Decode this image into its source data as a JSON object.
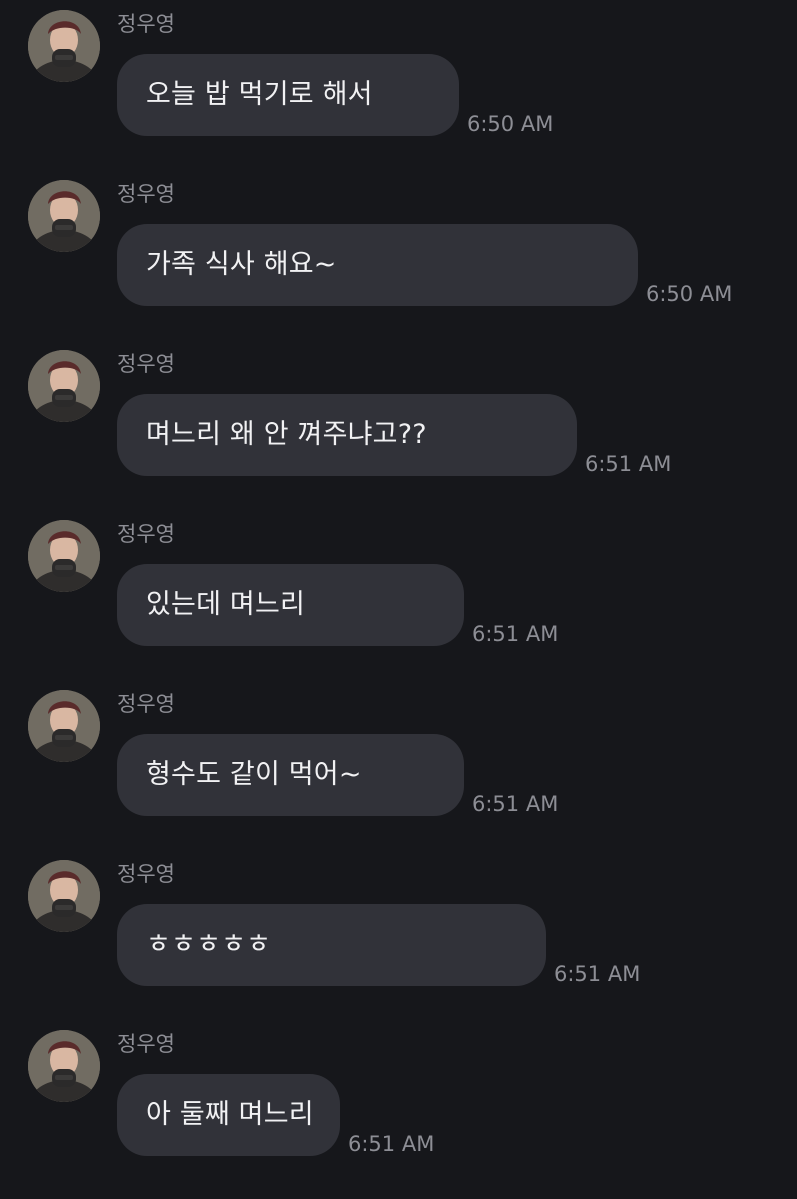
{
  "conversation": {
    "messages": [
      {
        "sender": "정우영",
        "text": "오늘 밥 먹기로 해서",
        "time": "6:50 AM"
      },
      {
        "sender": "정우영",
        "text": "가족 식사 해요~",
        "time": "6:50 AM"
      },
      {
        "sender": "정우영",
        "text": "며느리 왜 안 껴주냐고??",
        "time": "6:51 AM"
      },
      {
        "sender": "정우영",
        "text": "있는데 며느리",
        "time": "6:51 AM"
      },
      {
        "sender": "정우영",
        "text": "형수도 같이 먹어~",
        "time": "6:51 AM"
      },
      {
        "sender": "정우영",
        "text": "ㅎㅎㅎㅎㅎ",
        "time": "6:51 AM"
      },
      {
        "sender": "정우영",
        "text": "아 둘째 며느리",
        "time": "6:51 AM"
      }
    ]
  },
  "colors": {
    "background": "#16171b",
    "bubble": "#313239",
    "meta_text": "#8d8e95"
  },
  "icons": {
    "avatar": "profile-photo"
  }
}
